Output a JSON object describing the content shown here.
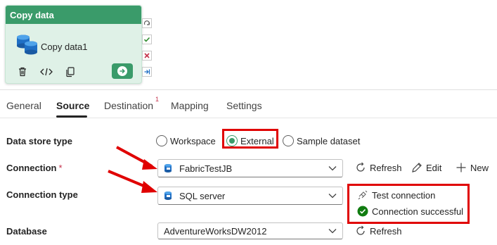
{
  "activity": {
    "header": "Copy data",
    "name": "Copy data1",
    "accent": "#3a9b6a"
  },
  "tabs": [
    {
      "label": "General"
    },
    {
      "label": "Source",
      "active": true
    },
    {
      "label": "Destination",
      "badge": "1"
    },
    {
      "label": "Mapping"
    },
    {
      "label": "Settings"
    }
  ],
  "form": {
    "data_store_type": {
      "label": "Data store type",
      "options": [
        "Workspace",
        "External",
        "Sample dataset"
      ],
      "selected": "External"
    },
    "connection": {
      "label": "Connection",
      "required_mark": "*",
      "value": "FabricTestJB",
      "actions": {
        "refresh": "Refresh",
        "edit": "Edit",
        "new": "New"
      }
    },
    "connection_type": {
      "label": "Connection type",
      "value": "SQL server",
      "test_connection": "Test connection",
      "status": "Connection successful",
      "status_color": "#107c10"
    },
    "database": {
      "label": "Database",
      "value": "AdventureWorksDW2012",
      "refresh": "Refresh"
    }
  },
  "annotation_color": "#e00000"
}
